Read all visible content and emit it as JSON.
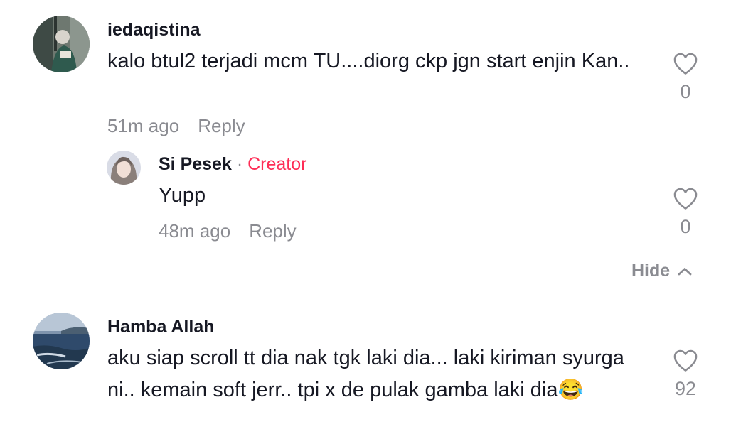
{
  "comments": [
    {
      "username": "iedaqistina",
      "text": "kalo btul2 terjadi mcm TU....diorg ckp jgn start enjin Kan..",
      "time": "51m ago",
      "reply_label": "Reply",
      "likes": "0"
    },
    {
      "username": "Si Pesek",
      "separator": "·",
      "badge": "Creator",
      "text": "Yupp",
      "time": "48m ago",
      "reply_label": "Reply",
      "likes": "0"
    },
    {
      "username": "Hamba Allah",
      "text": "aku siap scroll tt dia nak tgk laki dia... laki kiriman syurga ni.. kemain soft jerr.. tpi x de pulak gamba laki dia😂",
      "time": "",
      "reply_label": "",
      "likes": "92"
    }
  ],
  "replies_toggle": {
    "label": "Hide"
  },
  "icons": {
    "like": "heart-outline-icon",
    "collapse": "chevron-up-icon"
  },
  "colors": {
    "text": "#161823",
    "muted": "#8a8b91",
    "creator_badge": "#fe2c55",
    "background": "#ffffff"
  }
}
